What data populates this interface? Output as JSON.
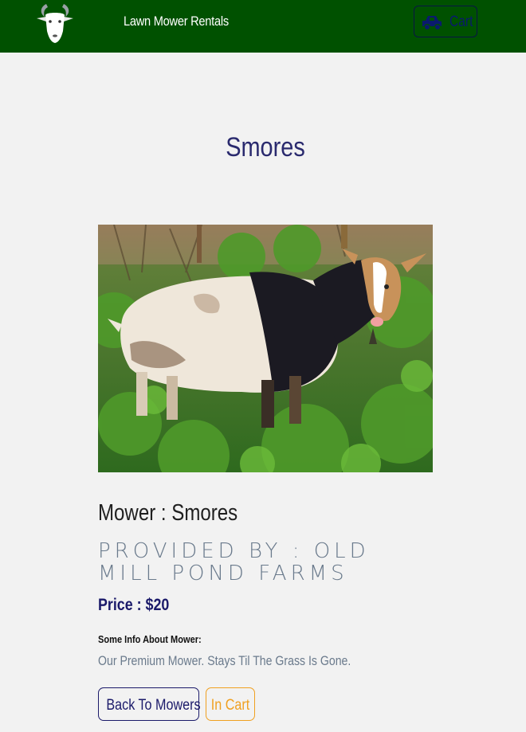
{
  "navbar": {
    "logo_icon": "goat-head-icon",
    "brand": "Lawn Mower Rentals",
    "cart": {
      "icon": "truck-icon",
      "label": "Cart"
    },
    "background": "#005100"
  },
  "page": {
    "title": "Smores"
  },
  "mower": {
    "photo_alt": "goat-photo",
    "name_line": "Mower : Smores",
    "provider_line": "Provided By : Old Mill Pond Farms",
    "price_line": "Price : $20",
    "info_heading": "Some Info About Mower:",
    "info_text": "Our Premium Mower. Stays Til The Grass Is Gone."
  },
  "actions": {
    "back_label": "Back To Mowers",
    "in_cart_label": "In Cart"
  },
  "colors": {
    "title": "#2a2a6e",
    "price": "#1b1a6a",
    "in_cart": "#f0a020",
    "muted": "#6a7a8c"
  }
}
